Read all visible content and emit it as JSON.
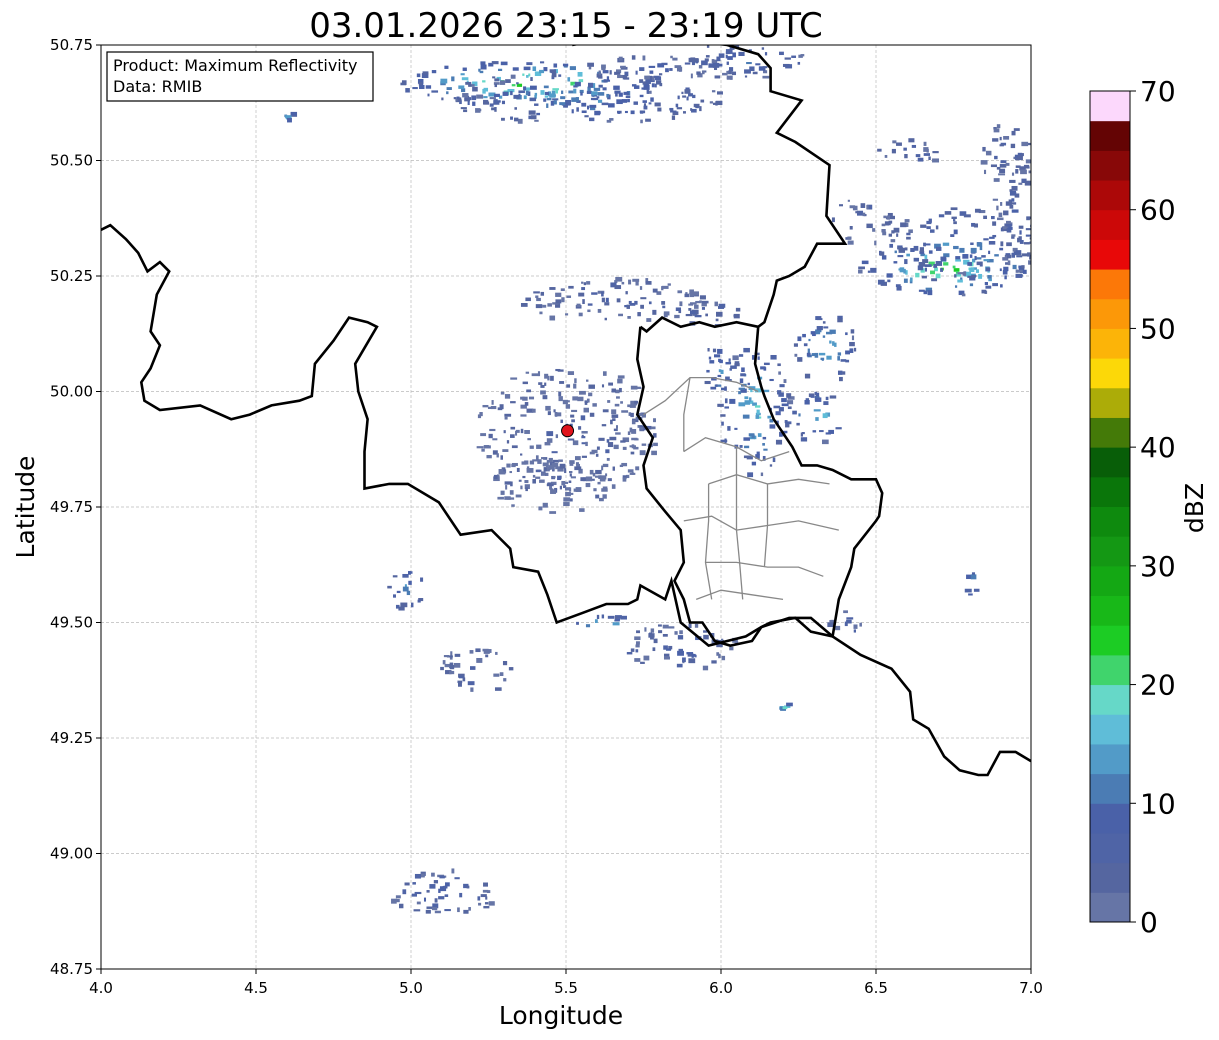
{
  "title": "03.01.2026 23:15 - 23:19 UTC",
  "info_box": {
    "product": "Product: Maximum Reflectivity",
    "data": "Data: RMIB"
  },
  "x_axis": {
    "label": "Longitude",
    "range": [
      4.0,
      7.0
    ],
    "ticks": [
      "4.0",
      "4.5",
      "5.0",
      "5.5",
      "6.0",
      "6.5",
      "7.0"
    ]
  },
  "y_axis": {
    "label": "Latitude",
    "range": [
      48.75,
      50.75
    ],
    "ticks": [
      "48.75",
      "49.00",
      "49.25",
      "49.50",
      "49.75",
      "50.00",
      "50.25",
      "50.50",
      "50.75"
    ]
  },
  "grid": true,
  "radar_site": {
    "lon": 5.505,
    "lat": 49.915,
    "color": "#e0141c"
  },
  "colorbar": {
    "label": "dBZ",
    "range": [
      0,
      70
    ],
    "ticks": [
      "0",
      "10",
      "20",
      "30",
      "40",
      "50",
      "60",
      "70"
    ],
    "step": 2.5,
    "colors": [
      "#6675a6",
      "#5566a0",
      "#4f64a6",
      "#4a61a8",
      "#4b7cb4",
      "#529bc8",
      "#5fbdd8",
      "#66d8c8",
      "#40d46c",
      "#1ccc24",
      "#18b818",
      "#14a814",
      "#149814",
      "#0e8a0e",
      "#0a760a",
      "#085e08",
      "#447a08",
      "#acac08",
      "#fcd808",
      "#fcb408",
      "#fc9808",
      "#fc7808",
      "#e80808",
      "#cc0808",
      "#ac0808",
      "#880808",
      "#640404",
      "#fcd8fc",
      "#fcb0fc",
      "#fc78fc",
      "#ec3cec"
    ]
  },
  "echo_clusters": [
    {
      "lon": 5.38,
      "lat": 50.67,
      "dlon": 0.42,
      "dlat": 0.05,
      "value": 24
    },
    {
      "lon": 5.55,
      "lat": 50.64,
      "dlon": 0.45,
      "dlat": 0.06,
      "value": 12
    },
    {
      "lon": 5.8,
      "lat": 50.7,
      "dlon": 0.25,
      "dlat": 0.03,
      "value": 8
    },
    {
      "lon": 6.05,
      "lat": 50.72,
      "dlon": 0.22,
      "dlat": 0.04,
      "value": 10
    },
    {
      "lon": 6.72,
      "lat": 50.27,
      "dlon": 0.28,
      "dlat": 0.06,
      "value": 23
    },
    {
      "lon": 6.75,
      "lat": 50.32,
      "dlon": 0.22,
      "dlat": 0.08,
      "value": 12
    },
    {
      "lon": 6.95,
      "lat": 50.38,
      "dlon": 0.08,
      "dlat": 0.12,
      "value": 8
    },
    {
      "lon": 6.6,
      "lat": 50.52,
      "dlon": 0.1,
      "dlat": 0.03,
      "value": 6
    },
    {
      "lon": 5.95,
      "lat": 50.17,
      "dlon": 0.12,
      "dlat": 0.03,
      "value": 6
    },
    {
      "lon": 5.65,
      "lat": 50.2,
      "dlon": 0.3,
      "dlat": 0.05,
      "value": 6
    },
    {
      "lon": 5.2,
      "lat": 50.63,
      "dlon": 0.06,
      "dlat": 0.02,
      "value": 5
    },
    {
      "lon": 5.1,
      "lat": 48.92,
      "dlon": 0.18,
      "dlat": 0.05,
      "value": 9
    },
    {
      "lon": 5.5,
      "lat": 49.92,
      "dlon": 0.3,
      "dlat": 0.14,
      "value": 4
    },
    {
      "lon": 5.45,
      "lat": 49.8,
      "dlon": 0.2,
      "dlat": 0.06,
      "value": 4
    },
    {
      "lon": 6.1,
      "lat": 49.96,
      "dlon": 0.12,
      "dlat": 0.14,
      "value": 18
    },
    {
      "lon": 6.33,
      "lat": 50.1,
      "dlon": 0.1,
      "dlat": 0.08,
      "value": 16
    },
    {
      "lon": 6.3,
      "lat": 49.95,
      "dlon": 0.08,
      "dlat": 0.06,
      "value": 18
    },
    {
      "lon": 5.98,
      "lat": 50.05,
      "dlon": 0.06,
      "dlat": 0.06,
      "value": 14
    },
    {
      "lon": 5.85,
      "lat": 49.45,
      "dlon": 0.2,
      "dlat": 0.05,
      "value": 8
    },
    {
      "lon": 5.62,
      "lat": 49.5,
      "dlon": 0.1,
      "dlat": 0.02,
      "value": 18
    },
    {
      "lon": 4.98,
      "lat": 49.58,
      "dlon": 0.06,
      "dlat": 0.05,
      "value": 14
    },
    {
      "lon": 5.2,
      "lat": 49.4,
      "dlon": 0.12,
      "dlat": 0.05,
      "value": 6
    },
    {
      "lon": 6.8,
      "lat": 49.59,
      "dlon": 0.02,
      "dlat": 0.03,
      "value": 20
    },
    {
      "lon": 6.2,
      "lat": 49.32,
      "dlon": 0.02,
      "dlat": 0.01,
      "value": 22
    },
    {
      "lon": 6.9,
      "lat": 50.52,
      "dlon": 0.1,
      "dlat": 0.06,
      "value": 6
    },
    {
      "lon": 6.45,
      "lat": 50.37,
      "dlon": 0.1,
      "dlat": 0.05,
      "value": 6
    },
    {
      "lon": 6.4,
      "lat": 49.5,
      "dlon": 0.06,
      "dlat": 0.03,
      "value": 6
    },
    {
      "lon": 4.6,
      "lat": 50.6,
      "dlon": 0.02,
      "dlat": 0.01,
      "value": 16
    }
  ],
  "borders": {
    "belgium_france": [
      [
        4.0,
        50.35
      ],
      [
        4.03,
        50.36
      ],
      [
        4.08,
        50.33
      ],
      [
        4.12,
        50.3
      ],
      [
        4.15,
        50.26
      ],
      [
        4.19,
        50.28
      ],
      [
        4.22,
        50.26
      ],
      [
        4.18,
        50.21
      ],
      [
        4.16,
        50.13
      ],
      [
        4.19,
        50.1
      ],
      [
        4.16,
        50.05
      ],
      [
        4.13,
        50.02
      ],
      [
        4.14,
        49.98
      ],
      [
        4.19,
        49.96
      ],
      [
        4.32,
        49.97
      ],
      [
        4.42,
        49.94
      ],
      [
        4.48,
        49.95
      ],
      [
        4.55,
        49.97
      ],
      [
        4.64,
        49.98
      ],
      [
        4.68,
        49.99
      ],
      [
        4.69,
        50.06
      ],
      [
        4.75,
        50.11
      ],
      [
        4.8,
        50.16
      ],
      [
        4.86,
        50.15
      ],
      [
        4.89,
        50.14
      ],
      [
        4.82,
        50.06
      ],
      [
        4.83,
        50.0
      ],
      [
        4.86,
        49.94
      ],
      [
        4.85,
        49.87
      ],
      [
        4.85,
        49.79
      ],
      [
        4.93,
        49.8
      ],
      [
        4.99,
        49.8
      ],
      [
        5.09,
        49.76
      ],
      [
        5.14,
        49.71
      ],
      [
        5.16,
        49.69
      ],
      [
        5.26,
        49.7
      ],
      [
        5.32,
        49.66
      ],
      [
        5.33,
        49.62
      ],
      [
        5.41,
        49.61
      ],
      [
        5.44,
        49.56
      ],
      [
        5.47,
        49.5
      ],
      [
        5.55,
        49.52
      ],
      [
        5.63,
        49.54
      ],
      [
        5.7,
        49.54
      ],
      [
        5.73,
        49.55
      ],
      [
        5.74,
        49.58
      ],
      [
        5.82,
        49.55
      ],
      [
        5.84,
        49.59
      ],
      [
        5.87,
        49.5
      ],
      [
        5.96,
        49.45
      ],
      [
        6.02,
        49.46
      ],
      [
        6.08,
        49.47
      ],
      [
        6.13,
        49.49
      ],
      [
        6.22,
        49.51
      ],
      [
        6.29,
        49.51
      ],
      [
        6.36,
        49.47
      ],
      [
        6.45,
        49.43
      ],
      [
        6.55,
        49.4
      ],
      [
        6.61,
        49.35
      ],
      [
        6.62,
        49.29
      ],
      [
        6.67,
        49.27
      ],
      [
        6.72,
        49.21
      ],
      [
        6.77,
        49.18
      ],
      [
        6.83,
        49.17
      ],
      [
        6.86,
        49.17
      ],
      [
        6.9,
        49.22
      ],
      [
        6.95,
        49.22
      ],
      [
        7.0,
        49.2
      ]
    ],
    "belgium_netherlands": [
      [
        5.52,
        50.75
      ],
      [
        5.6,
        50.76
      ],
      [
        5.7,
        50.76
      ],
      [
        5.78,
        50.78
      ],
      [
        5.9,
        50.76
      ],
      [
        6.02,
        50.75
      ],
      [
        6.12,
        50.73
      ],
      [
        6.16,
        50.7
      ],
      [
        6.16,
        50.65
      ],
      [
        6.26,
        50.63
      ],
      [
        6.18,
        50.56
      ],
      [
        6.24,
        50.54
      ],
      [
        6.35,
        50.49
      ],
      [
        6.34,
        50.38
      ],
      [
        6.4,
        50.32
      ],
      [
        6.31,
        50.32
      ],
      [
        6.27,
        50.27
      ],
      [
        6.22,
        50.25
      ],
      [
        6.18,
        50.24
      ],
      [
        6.17,
        50.21
      ],
      [
        6.14,
        50.15
      ],
      [
        6.12,
        50.14
      ]
    ],
    "luxembourg_outer": [
      [
        5.74,
        50.14
      ],
      [
        5.76,
        50.13
      ],
      [
        5.81,
        50.16
      ],
      [
        5.87,
        50.14
      ],
      [
        5.93,
        50.15
      ],
      [
        5.98,
        50.14
      ],
      [
        6.05,
        50.15
      ],
      [
        6.12,
        50.14
      ],
      [
        6.11,
        50.06
      ],
      [
        6.13,
        50.01
      ],
      [
        6.14,
        49.99
      ],
      [
        6.17,
        49.94
      ],
      [
        6.23,
        49.88
      ],
      [
        6.26,
        49.84
      ],
      [
        6.31,
        49.84
      ],
      [
        6.36,
        49.83
      ],
      [
        6.42,
        49.81
      ],
      [
        6.5,
        49.81
      ],
      [
        6.52,
        49.78
      ],
      [
        6.51,
        49.73
      ],
      [
        6.5,
        49.72
      ],
      [
        6.43,
        49.66
      ],
      [
        6.42,
        49.62
      ],
      [
        6.38,
        49.55
      ],
      [
        6.36,
        49.47
      ],
      [
        6.29,
        49.48
      ],
      [
        6.24,
        49.51
      ],
      [
        6.16,
        49.5
      ],
      [
        6.13,
        49.49
      ],
      [
        6.1,
        49.46
      ],
      [
        6.03,
        49.45
      ],
      [
        5.98,
        49.46
      ],
      [
        5.94,
        49.5
      ],
      [
        5.9,
        49.5
      ],
      [
        5.88,
        49.55
      ],
      [
        5.85,
        49.59
      ],
      [
        5.88,
        49.63
      ],
      [
        5.87,
        49.7
      ],
      [
        5.82,
        49.74
      ],
      [
        5.76,
        49.79
      ],
      [
        5.75,
        49.84
      ],
      [
        5.78,
        49.9
      ],
      [
        5.73,
        49.95
      ],
      [
        5.75,
        50.01
      ],
      [
        5.73,
        50.07
      ],
      [
        5.74,
        50.14
      ]
    ],
    "internal": [
      [
        [
          5.75,
          49.95
        ],
        [
          5.82,
          49.98
        ],
        [
          5.9,
          50.03
        ],
        [
          5.97,
          50.03
        ],
        [
          6.05,
          50.02
        ],
        [
          6.12,
          50.0
        ]
      ],
      [
        [
          5.88,
          49.87
        ],
        [
          5.95,
          49.9
        ],
        [
          6.05,
          49.88
        ],
        [
          6.13,
          49.85
        ],
        [
          6.22,
          49.87
        ]
      ],
      [
        [
          5.96,
          49.8
        ],
        [
          6.05,
          49.82
        ],
        [
          6.15,
          49.8
        ],
        [
          6.25,
          49.81
        ],
        [
          6.35,
          49.8
        ]
      ],
      [
        [
          5.88,
          49.72
        ],
        [
          5.97,
          49.73
        ],
        [
          6.05,
          49.7
        ],
        [
          6.15,
          49.71
        ],
        [
          6.25,
          49.72
        ],
        [
          6.38,
          49.7
        ]
      ],
      [
        [
          5.95,
          49.63
        ],
        [
          6.05,
          49.63
        ],
        [
          6.15,
          49.62
        ],
        [
          6.25,
          49.62
        ],
        [
          6.33,
          49.6
        ]
      ],
      [
        [
          5.92,
          49.55
        ],
        [
          6.0,
          49.57
        ],
        [
          6.1,
          49.56
        ],
        [
          6.2,
          49.55
        ]
      ],
      [
        [
          5.96,
          49.8
        ],
        [
          5.96,
          49.72
        ],
        [
          5.95,
          49.63
        ],
        [
          5.97,
          49.55
        ]
      ],
      [
        [
          6.15,
          49.8
        ],
        [
          6.15,
          49.71
        ],
        [
          6.14,
          49.62
        ]
      ],
      [
        [
          6.05,
          49.88
        ],
        [
          6.05,
          49.82
        ],
        [
          6.05,
          49.7
        ],
        [
          6.06,
          49.63
        ],
        [
          6.07,
          49.55
        ]
      ],
      [
        [
          5.9,
          50.03
        ],
        [
          5.88,
          49.95
        ],
        [
          5.88,
          49.87
        ]
      ]
    ]
  }
}
